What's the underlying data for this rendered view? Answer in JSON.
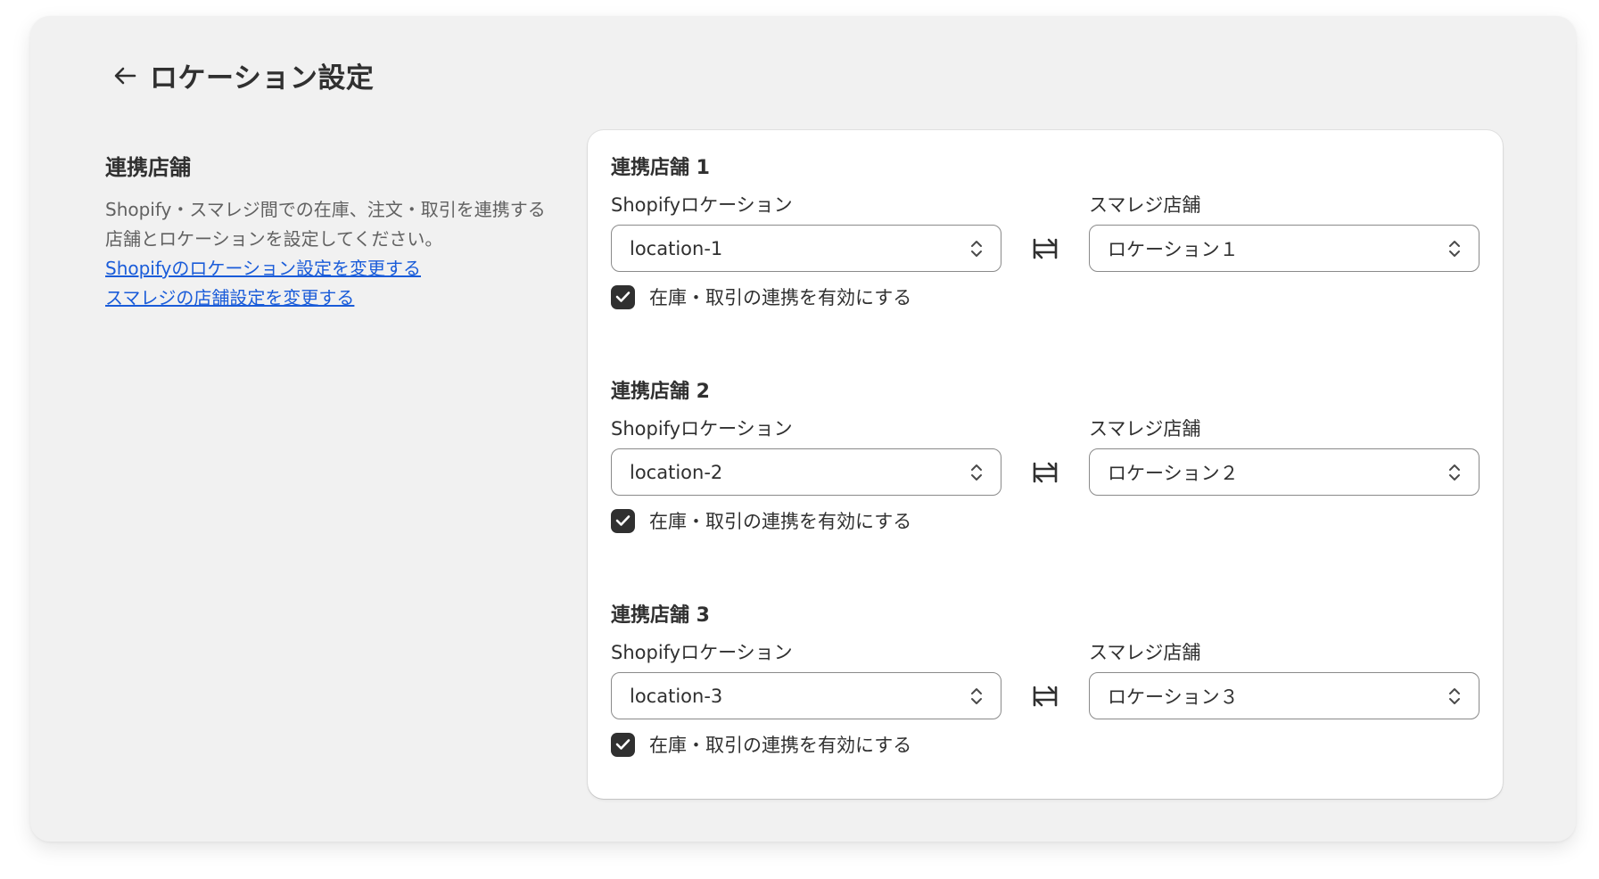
{
  "header": {
    "title": "ロケーション設定"
  },
  "side": {
    "title": "連携店舗",
    "description": "Shopify・スマレジ間での在庫、注文・取引を連携する店舗とロケーションを設定してください。",
    "link_shopify": "Shopifyのロケーション設定を変更する",
    "link_smaregi": "スマレジの店舗設定を変更する",
    "link_color": "#1a5cd9"
  },
  "groups": [
    {
      "title": "連携店舗 1",
      "shopify_label": "Shopifyロケーション",
      "shopify_value": "location-1",
      "smaregi_label": "スマレジ店舗",
      "smaregi_value": "ロケーション１",
      "checkbox_label": "在庫・取引の連携を有効にする",
      "checked": true
    },
    {
      "title": "連携店舗 2",
      "shopify_label": "Shopifyロケーション",
      "shopify_value": "location-2",
      "smaregi_label": "スマレジ店舗",
      "smaregi_value": "ロケーション２",
      "checkbox_label": "在庫・取引の連携を有効にする",
      "checked": true
    },
    {
      "title": "連携店舗 3",
      "shopify_label": "Shopifyロケーション",
      "shopify_value": "location-3",
      "smaregi_label": "スマレジ店舗",
      "smaregi_value": "ロケーション３",
      "checkbox_label": "在庫・取引の連携を有効にする",
      "checked": true
    }
  ],
  "icons": {
    "back": "arrow-left-icon",
    "select": "chevron-up-down-icon",
    "sync": "arrows-exchange-icon",
    "check": "checkmark-icon"
  }
}
